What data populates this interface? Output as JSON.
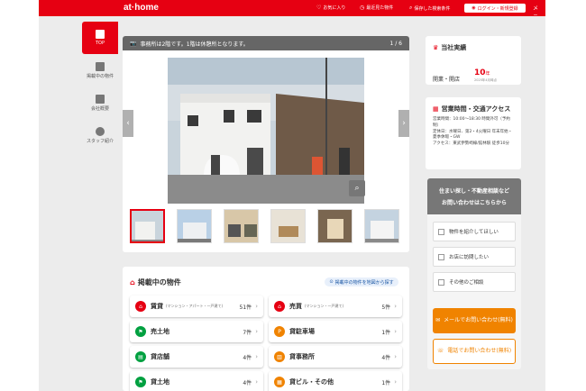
{
  "header": {
    "logo": "at·home",
    "nav": [
      {
        "icon": "heart-icon",
        "label": "お気に入り"
      },
      {
        "icon": "history-icon",
        "label": "最近見た物件"
      },
      {
        "icon": "search-icon",
        "label": "保存した検索条件"
      }
    ],
    "login_label": "ログイン・新規登録",
    "menu_label": "メニュー"
  },
  "sidenav": [
    {
      "label": "TOP",
      "active": true
    },
    {
      "label": "掲載中の物件",
      "active": false
    },
    {
      "label": "会社概要",
      "active": false
    },
    {
      "label": "スタッフ紹介",
      "active": false
    }
  ],
  "gallery": {
    "caption": "事務所は2階です。1階は休憩所となります。",
    "counter": "1 / 6"
  },
  "listings": {
    "title": "掲載中の物件",
    "map_link": "掲載中の物件を地図から探す",
    "items": [
      {
        "name": "賃貸",
        "sub": "(マンション・アパート・一戸建て)",
        "count": "51件",
        "color": "#e60012",
        "icon": "house-icon"
      },
      {
        "name": "売買",
        "sub": "(マンション・一戸建て)",
        "count": "5件",
        "color": "#e60012",
        "icon": "house-icon"
      },
      {
        "name": "売土地",
        "sub": "",
        "count": "7件",
        "color": "#00a040",
        "icon": "flag-icon"
      },
      {
        "name": "貸駐車場",
        "sub": "",
        "count": "1件",
        "color": "#f08300",
        "icon": "parking-icon"
      },
      {
        "name": "貸店舗",
        "sub": "",
        "count": "4件",
        "color": "#00a040",
        "icon": "shop-icon"
      },
      {
        "name": "貸事務所",
        "sub": "",
        "count": "4件",
        "color": "#f08300",
        "icon": "office-icon"
      },
      {
        "name": "貸土地",
        "sub": "",
        "count": "4件",
        "color": "#00a040",
        "icon": "flag-icon"
      },
      {
        "name": "貸ビル・その他",
        "sub": "",
        "count": "1件",
        "color": "#f08300",
        "icon": "building-icon"
      }
    ]
  },
  "record": {
    "title": "当社実績",
    "label": "開業・開店",
    "value": "10",
    "unit": "年",
    "note": "2025年4月時点"
  },
  "hours": {
    "title": "営業時間・交通アクセス",
    "lines": [
      "営業時間：10:00〜18:30 時間外可（予約制）",
      "定休日：水曜日、第2・4火曜日 年末年始・夏季休暇・GW",
      "アクセス：東武伊勢崎線/館林駅 徒歩10分"
    ]
  },
  "contact": {
    "head_line1": "住まい探し・不動産相談など",
    "head_line2": "お問い合わせはこちらから",
    "options": [
      "物件を紹介してほしい",
      "お店に訪問したい",
      "その他のご相談"
    ],
    "mail_button": "メールでお問い合わせ(無料)",
    "phone_button": "電話でお問い合わせ(無料)"
  }
}
